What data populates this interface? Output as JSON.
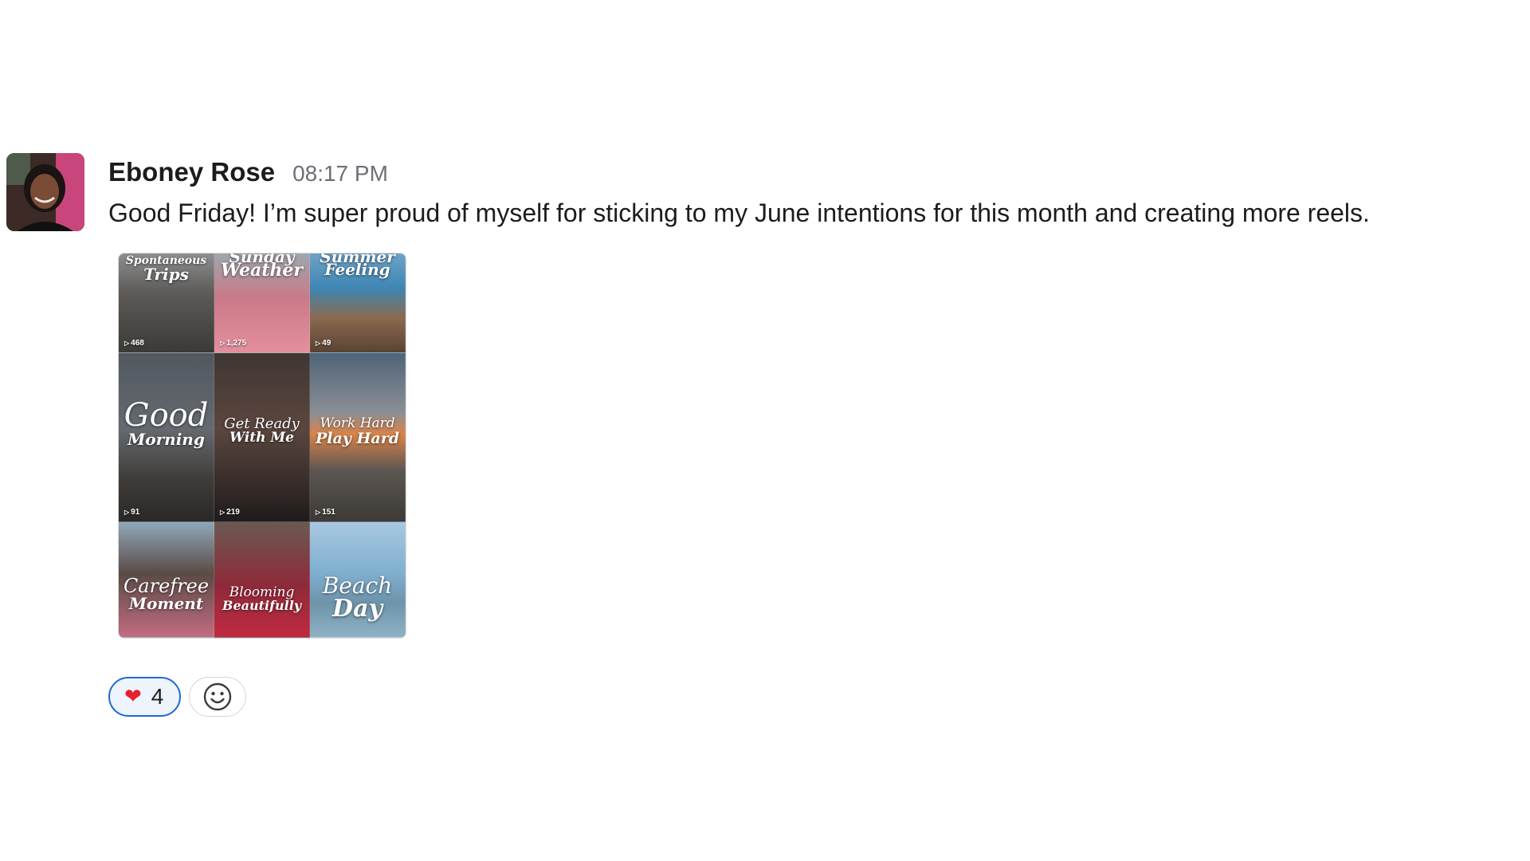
{
  "message": {
    "author": "Eboney Rose",
    "timestamp": "08:17 PM",
    "text": "Good Friday! I’m super proud of myself for sticking to my June intentions for this month and creating more reels."
  },
  "attachment": {
    "tiles": [
      {
        "title_line1": "Spontaneous",
        "title_line2": "Trips",
        "count": "468"
      },
      {
        "title_line1": "Sunday",
        "title_line2": "Weather",
        "count": "1,275"
      },
      {
        "title_line1": "Summer",
        "title_line2": "Feeling",
        "count": "49"
      },
      {
        "title_line1": "Good",
        "title_line2": "Morning",
        "count": "91"
      },
      {
        "title_line1": "Get Ready",
        "title_line2": "With Me",
        "count": "219"
      },
      {
        "title_line1": "Work Hard",
        "title_line2": "Play Hard",
        "count": "151"
      },
      {
        "title_line1": "Carefree",
        "title_line2": "Moment",
        "count": ""
      },
      {
        "title_line1": "Blooming",
        "title_line2": "Beautifully",
        "count": ""
      },
      {
        "title_line1": "Beach",
        "title_line2": "Day",
        "count": ""
      }
    ]
  },
  "reactions": [
    {
      "emoji": "❤",
      "emoji_name": "red-heart",
      "count": "4",
      "selected": true
    }
  ],
  "add_reaction_icon": "smiley-face-icon",
  "colors": {
    "reaction_border": "#1e68d6",
    "reaction_bg": "#eef4fc",
    "text": "#1d1c1d",
    "timestamp": "#6b6f76"
  }
}
